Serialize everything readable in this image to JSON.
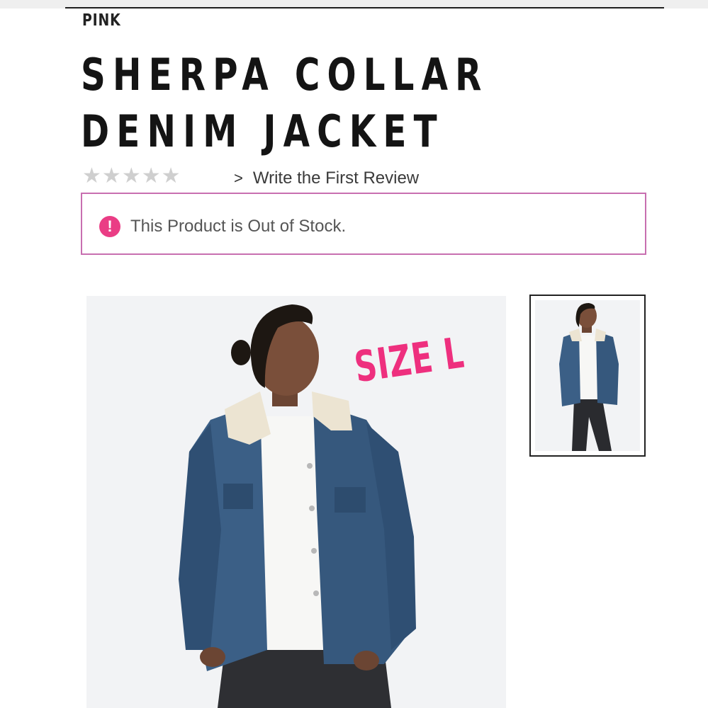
{
  "product": {
    "brand": "PINK",
    "title_line1": "SHERPA COLLAR",
    "title_line2": "DENIM JACKET"
  },
  "rating": {
    "stars": 5,
    "filled": 0,
    "review_link_label": "Write the First Review",
    "chevron_glyph": ">"
  },
  "alert": {
    "icon_glyph": "!",
    "message": "This Product is Out of Stock."
  },
  "images": {
    "overlay_text": "SIZE L",
    "main_icon": "product-photo",
    "thumbnail_icon": "product-thumbnail"
  },
  "colors": {
    "accent_pink": "#ee2f7e",
    "alert_border": "#c86fb0",
    "alert_icon": "#ea3d85",
    "denim": "#3b5f86",
    "star_empty": "#cfcfcf"
  }
}
